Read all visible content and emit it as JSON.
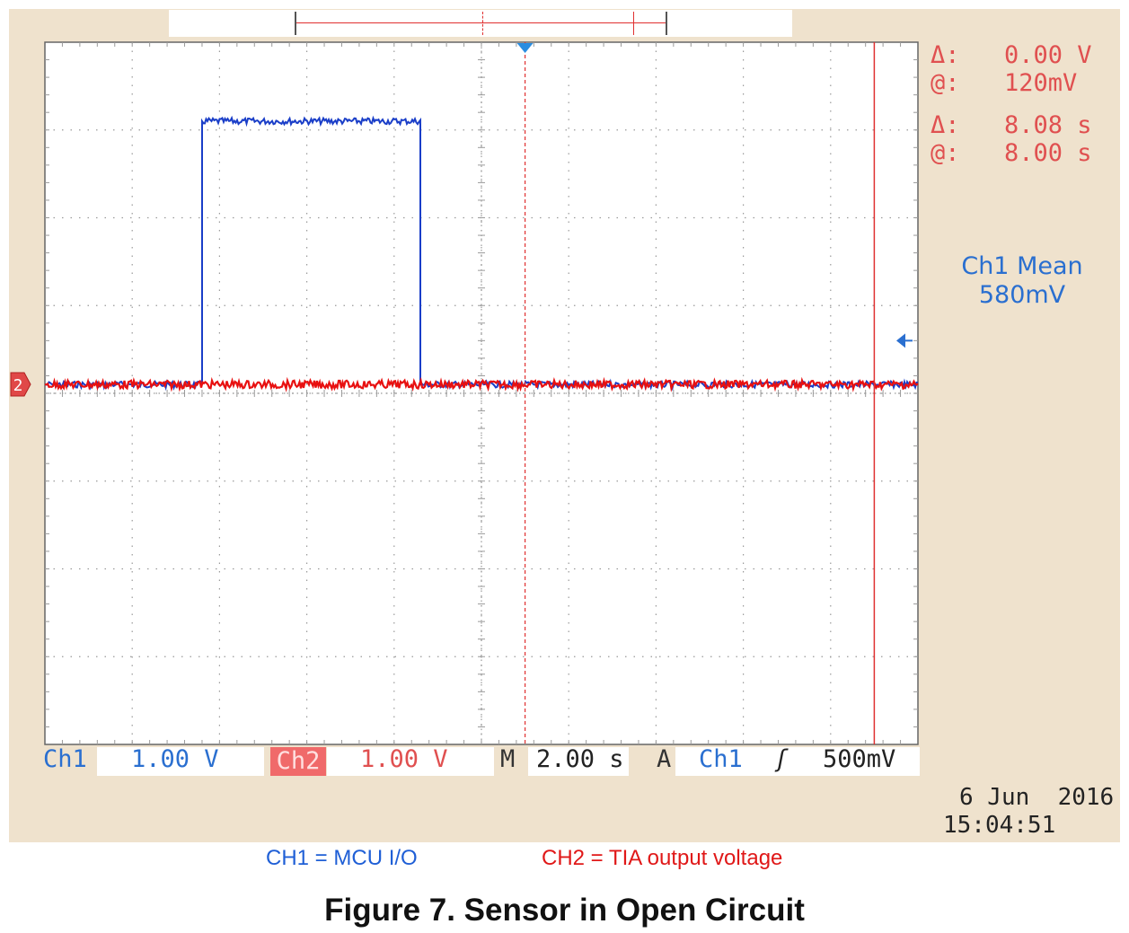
{
  "figure_title": "Figure 7. Sensor in Open Circuit",
  "legend": {
    "ch1": "CH1 = MCU I/O",
    "ch2": "CH2 = TIA output voltage"
  },
  "cursor_readouts": {
    "delta_v_symbol": "Δ:",
    "delta_v_value": "0.00 V",
    "at_v_symbol": "@:",
    "at_v_value": "120mV",
    "delta_t_symbol": "Δ:",
    "delta_t_value": "8.08 s",
    "at_t_symbol": "@:",
    "at_t_value": "8.00 s"
  },
  "measurement": {
    "label": "Ch1 Mean",
    "value": "580mV"
  },
  "status_bar": {
    "ch1_label": "Ch1",
    "ch1_scale": "1.00 V",
    "ch2_label": "Ch2",
    "ch2_scale": "1.00 V",
    "timebase_label": "M",
    "timebase": "2.00 s",
    "trigger_mode": "A",
    "trigger_source": "Ch1",
    "trigger_slope_symbol": "ʃ",
    "trigger_level": "500mV"
  },
  "timestamp": {
    "date": "6 Jun  2016",
    "time": "15:04:51"
  },
  "channel_marker": "2",
  "colors": {
    "ch1": "#1a3ec8",
    "ch2": "#e81010",
    "cursor": "#e03030",
    "background": "#efe2cd",
    "grid": "#9a9a9a"
  },
  "chart_data": {
    "type": "line",
    "divisions_x": 10,
    "divisions_y": 8,
    "x_units": "s",
    "xlim": [
      -11,
      9
    ],
    "ylim": [
      -4.1,
      3.9
    ],
    "series": [
      {
        "name": "CH1 = MCU I/O",
        "color": "#1a3ec8",
        "points": [
          [
            -11,
            0
          ],
          [
            -7.4,
            0
          ],
          [
            -7.4,
            3
          ],
          [
            -2.4,
            3
          ],
          [
            -2.4,
            0
          ],
          [
            9,
            0
          ]
        ]
      },
      {
        "name": "CH2 = TIA output voltage",
        "color": "#e81010",
        "points": [
          [
            -11,
            0
          ],
          [
            9,
            0
          ]
        ]
      }
    ],
    "trigger_time": 0,
    "cursor_time": 8.0,
    "ch1_ground_volts": 0,
    "ch1_arrow_volts": 0.5
  }
}
